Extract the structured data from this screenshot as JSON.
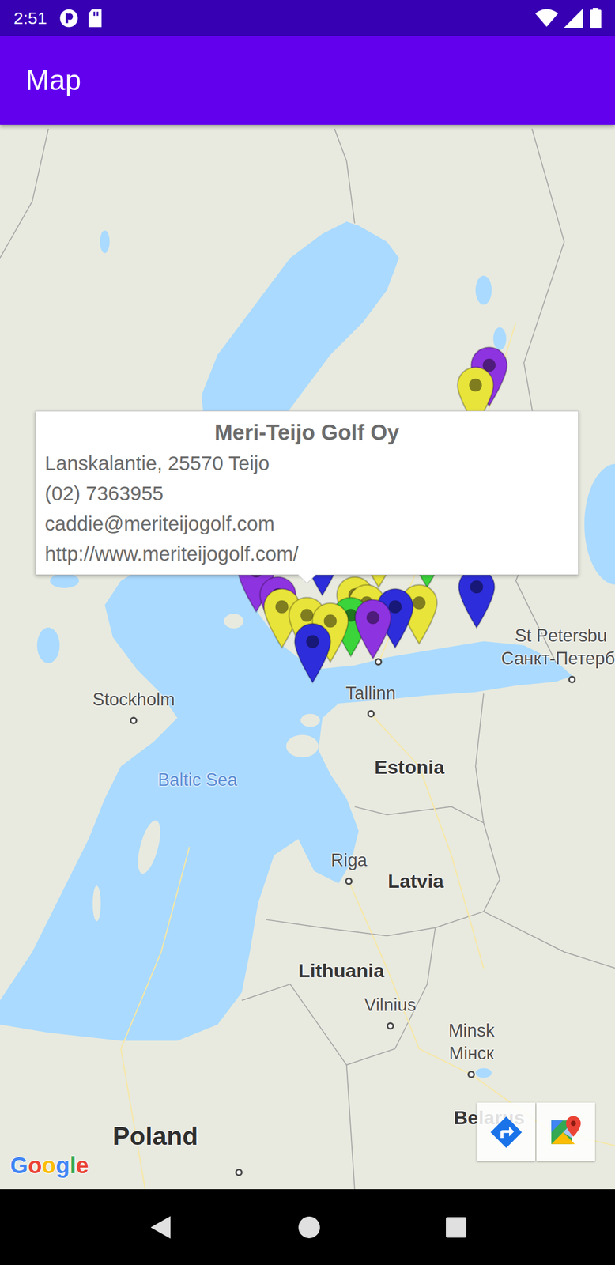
{
  "status_bar": {
    "time": "2:51"
  },
  "app_bar": {
    "title": "Map"
  },
  "map": {
    "labels": [
      {
        "text": "Stockholm",
        "kind": "city",
        "lat": 59.34,
        "lng": 18.07
      },
      {
        "text": "Baltic Sea",
        "kind": "sea",
        "lat": 58.45,
        "lng": 19.87
      },
      {
        "text": "Tallinn",
        "kind": "city",
        "lat": 59.44,
        "lng": 24.75
      },
      {
        "text": "Estonia",
        "kind": "country",
        "lat": 58.65,
        "lng": 25.84
      },
      {
        "text": "Riga",
        "kind": "city",
        "lat": 56.95,
        "lng": 24.14
      },
      {
        "text": "Latvia",
        "kind": "country",
        "lat": 56.95,
        "lng": 26.02
      },
      {
        "text": "Lithuania",
        "kind": "country",
        "lat": 55.62,
        "lng": 23.92
      },
      {
        "text": "Vilnius",
        "kind": "city",
        "lat": 54.8,
        "lng": 25.3
      },
      {
        "text": "Minsk",
        "subtext": "Мінск",
        "kind": "city",
        "lat": 54.08,
        "lng": 27.59
      },
      {
        "text": "Belarus",
        "kind": "country",
        "lat": 53.44,
        "lng": 28.09
      },
      {
        "text": "Poland",
        "kind": "country_large",
        "lat": 53.16,
        "lng": 18.68
      },
      {
        "text": "St Petersbu",
        "subtext": "Санкт-Петерб",
        "kind": "edge_city",
        "lat": 59.95,
        "lng": 30.42
      },
      {
        "kind": "dot",
        "lat": 60.21,
        "lng": 24.96
      },
      {
        "kind": "dot",
        "lat": 52.62,
        "lng": 21.03
      }
    ],
    "pins": [
      {
        "lat": 64.0,
        "lng": 28.09,
        "color": "#8e33e0",
        "selected": false
      },
      {
        "lat": 63.7,
        "lng": 27.7,
        "color": "#e8e43a",
        "selected": false
      },
      {
        "lat": 61.3,
        "lng": 26.34,
        "color": "#3bd43b",
        "selected": false
      },
      {
        "lat": 61.3,
        "lng": 24.97,
        "color": "#e8e43a",
        "selected": false
      },
      {
        "lat": 61.18,
        "lng": 23.39,
        "color": "#2d2ddb",
        "selected": false
      },
      {
        "lat": 60.94,
        "lng": 21.52,
        "color": "#8e33e0",
        "selected": false
      },
      {
        "lat": 60.7,
        "lng": 27.74,
        "color": "#2d2ddb",
        "selected": false
      },
      {
        "lat": 60.58,
        "lng": 22.13,
        "color": "#8e33e0",
        "selected": false
      },
      {
        "lat": 60.58,
        "lng": 24.3,
        "color": "#e8e43a",
        "selected": false
      },
      {
        "lat": 60.46,
        "lng": 24.64,
        "color": "#e8e43a",
        "selected": false
      },
      {
        "lat": 60.46,
        "lng": 26.11,
        "color": "#e8e43a",
        "selected": false
      },
      {
        "lat": 60.4,
        "lng": 22.25,
        "color": "#e8e43a",
        "selected": false
      },
      {
        "lat": 60.4,
        "lng": 25.44,
        "color": "#2d2ddb",
        "selected": false
      },
      {
        "lat": 60.28,
        "lng": 22.95,
        "color": "#e8e43a",
        "selected": true
      },
      {
        "lat": 60.28,
        "lng": 24.19,
        "color": "#3bd43b",
        "selected": false
      },
      {
        "lat": 60.24,
        "lng": 24.81,
        "color": "#8e33e0",
        "selected": false
      },
      {
        "lat": 60.19,
        "lng": 23.61,
        "color": "#e8e43a",
        "selected": false
      },
      {
        "lat": 59.89,
        "lng": 23.11,
        "color": "#2d2ddb",
        "selected": false
      }
    ],
    "attribution": "Google"
  },
  "info_window": {
    "title": "Meri-Teijo Golf Oy",
    "lines": [
      "Lanskalantie, 25570 Teijo",
      "(02) 7363955",
      "caddie@meriteijogolf.com",
      "http://www.meriteijogolf.com/"
    ]
  }
}
